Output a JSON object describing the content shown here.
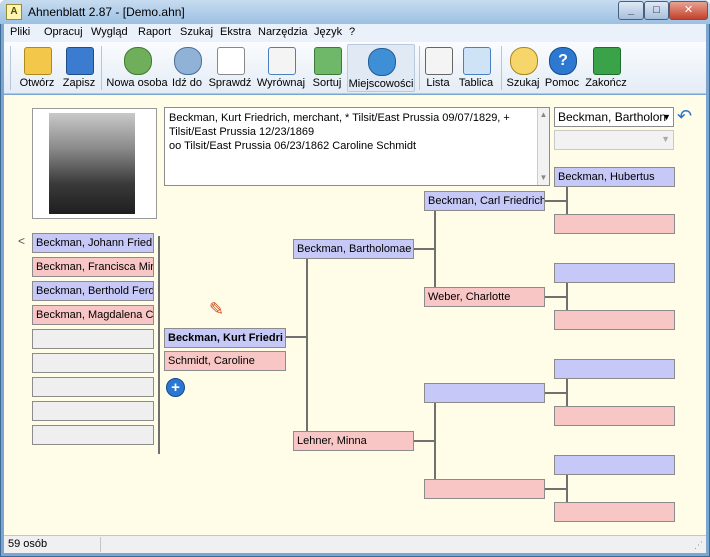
{
  "window": {
    "app_icon": "ancestor-chart-icon",
    "title": "Ahnenblatt 2.87 - [Demo.ahn]",
    "minimize": "_",
    "maximize": "□",
    "close": "✕"
  },
  "menu": [
    "Pliki",
    "Opracuj",
    "Wygląd",
    "Raport",
    "Szukaj",
    "Ekstra",
    "Narzędzia",
    "Język",
    "?"
  ],
  "toolbar": [
    {
      "label": "Otwórz",
      "icon": "folder-open-icon"
    },
    {
      "label": "Zapisz",
      "icon": "floppy-disk-icon"
    },
    {
      "label": "Nowa osoba",
      "icon": "add-person-icon"
    },
    {
      "label": "Idź do",
      "icon": "go-to-person-icon"
    },
    {
      "label": "Sprawdź",
      "icon": "checklist-icon"
    },
    {
      "label": "Wyrównaj",
      "icon": "align-text-icon"
    },
    {
      "label": "Sortuj",
      "icon": "sort-bars-icon"
    },
    {
      "label": "Miejscowości",
      "icon": "globe-icon"
    },
    {
      "label": "Lista",
      "icon": "list-document-icon"
    },
    {
      "label": "Tablica",
      "icon": "family-tree-table-icon"
    },
    {
      "label": "Szukaj",
      "icon": "magnifier-icon"
    },
    {
      "label": "Pomoc",
      "icon": "help-icon"
    },
    {
      "label": "Zakończ",
      "icon": "exit-door-icon"
    }
  ],
  "info_text_line1": "Beckman, Kurt Friedrich, merchant, * Tilsit/East Prussia 09/07/1829, +",
  "info_text_line2": "Tilsit/East Prussia 12/23/1869",
  "info_text_line3": "oo Tilsit/East Prussia 06/23/1862 Caroline Schmidt",
  "selector": {
    "value": "Beckman, Bartholon",
    "second_value": ""
  },
  "children_nav": "<",
  "children": [
    {
      "name": "Beckman, Johann Fried",
      "sex": "m"
    },
    {
      "name": "Beckman, Francisca Mir",
      "sex": "f"
    },
    {
      "name": "Beckman, Berthold Ferd",
      "sex": "m"
    },
    {
      "name": "Beckman, Magdalena C",
      "sex": "f"
    },
    {
      "name": "",
      "sex": "e"
    },
    {
      "name": "",
      "sex": "e"
    },
    {
      "name": "",
      "sex": "e"
    },
    {
      "name": "",
      "sex": "e"
    },
    {
      "name": "",
      "sex": "e"
    }
  ],
  "proband": "Beckman, Kurt Friedri",
  "spouse": "Schmidt, Caroline",
  "parents": {
    "father": "Beckman, Bartholomae",
    "mother": "Lehner, Minna"
  },
  "grandparents": {
    "pat_gf": "Beckman, Carl Friedrich",
    "pat_gm": "Weber, Charlotte",
    "mat_gf": "",
    "mat_gm": ""
  },
  "great_grandparents": [
    "Beckman, Hubertus",
    "",
    "",
    "",
    "",
    "",
    "",
    ""
  ],
  "status": "59 osób",
  "colors": {
    "male": "#c6c9f7",
    "female": "#f9c6c6",
    "empty": "#efefef",
    "background": "#fffde8"
  }
}
